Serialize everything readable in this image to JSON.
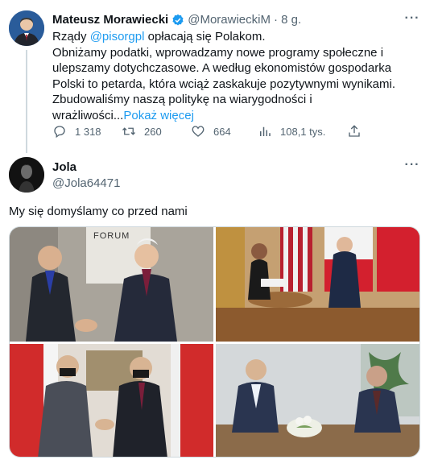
{
  "tweet": {
    "author_name": "Mateusz Morawiecki",
    "author_handle": "@MorawieckiM",
    "time": "· 8 g.",
    "more_icon_label": "···",
    "text_line1_prefix": "Rządy ",
    "text_mention": "@pisorgpl",
    "text_line1_suffix": " opłacają się Polakom.",
    "text_line2": "Obniżamy podatki, wprowadzamy nowe programy społeczne i ulepszamy dotychczasowe. A według ekonomistów gospodarka Polski to petarda, która wciąż zaskakuje pozytywnymi wynikami.",
    "text_line3": "Zbudowaliśmy naszą politykę na wiarygodności i wrażliwości...",
    "show_more": "Pokaż więcej",
    "stats": {
      "replies": "1 318",
      "retweets": "260",
      "likes": "664",
      "views": "108,1 tys."
    }
  },
  "reply": {
    "author_name": "Jola",
    "author_handle": "@Jola64471",
    "more_icon_label": "···",
    "text": "My się domyślamy co przed nami",
    "photos": [
      {
        "caption_text": "FORUM"
      },
      {
        "caption_text": ""
      },
      {
        "caption_text": ""
      },
      {
        "caption_text": ""
      }
    ]
  },
  "colors": {
    "accent": "#1d9bf0",
    "secondary_text": "#536471",
    "verified": "#1d9bf0"
  }
}
